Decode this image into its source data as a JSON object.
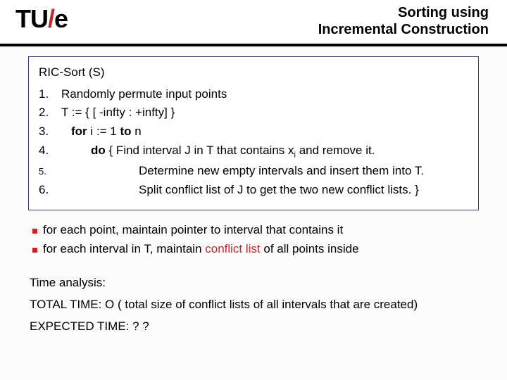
{
  "logo": {
    "tu": "TU",
    "slash": "/",
    "e": "e"
  },
  "title_line1": "Sorting using",
  "title_line2": "Incremental Construction",
  "algo": {
    "header": "RIC-Sort (S)",
    "rows": [
      {
        "n": "1.",
        "text": "Randomly permute input points"
      },
      {
        "n": "2.",
        "text": "T := {  [ -infty : +infty]  }"
      },
      {
        "n": "3.",
        "kw": "for",
        "text": " i := 1 ",
        "kw2": "to",
        "text2": " n"
      },
      {
        "n": "4.",
        "kw": "do",
        "text": "   { Find interval J in T that contains x",
        "sub": "i",
        "tail": " and remove it."
      },
      {
        "n": "5.",
        "text": "Determine new empty intervals and insert them into T."
      },
      {
        "n": "6.",
        "text": "Split conflict list of J to get the two new conflict lists. }"
      }
    ]
  },
  "bullet1_a": "for each point, maintain pointer to interval that contains it",
  "bullet2_a": "for each interval in T, maintain ",
  "bullet2_conflict": "conflict list",
  "bullet2_b": " of all points inside",
  "analysis": {
    "hdr": "Time analysis:",
    "total": "TOTAL TIME:  O ( total size of conflict lists of all intervals that are created)",
    "expected": "EXPECTED TIME:  ? ?"
  }
}
